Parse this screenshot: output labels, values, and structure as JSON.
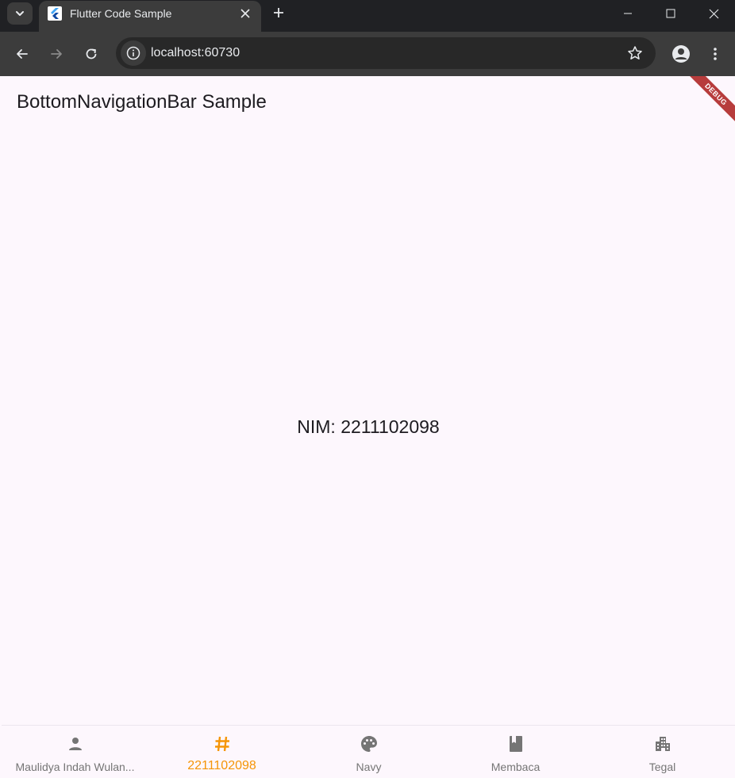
{
  "browser": {
    "tab_title": "Flutter Code Sample",
    "url": "localhost:60730"
  },
  "app": {
    "title": "BottomNavigationBar Sample",
    "debug_banner": "DEBUG",
    "body_text": "NIM: 2211102098"
  },
  "bottom_nav": {
    "items": [
      {
        "label": "Maulidya Indah Wulan...",
        "icon": "person-icon",
        "selected": false
      },
      {
        "label": "2211102098",
        "icon": "hashtag-icon",
        "selected": true
      },
      {
        "label": "Navy",
        "icon": "palette-icon",
        "selected": false
      },
      {
        "label": "Membaca",
        "icon": "book-icon",
        "selected": false
      },
      {
        "label": "Tegal",
        "icon": "city-icon",
        "selected": false
      }
    ]
  },
  "colors": {
    "accent": "#f59507",
    "inactive": "#757575",
    "background": "#fdf7fd"
  }
}
